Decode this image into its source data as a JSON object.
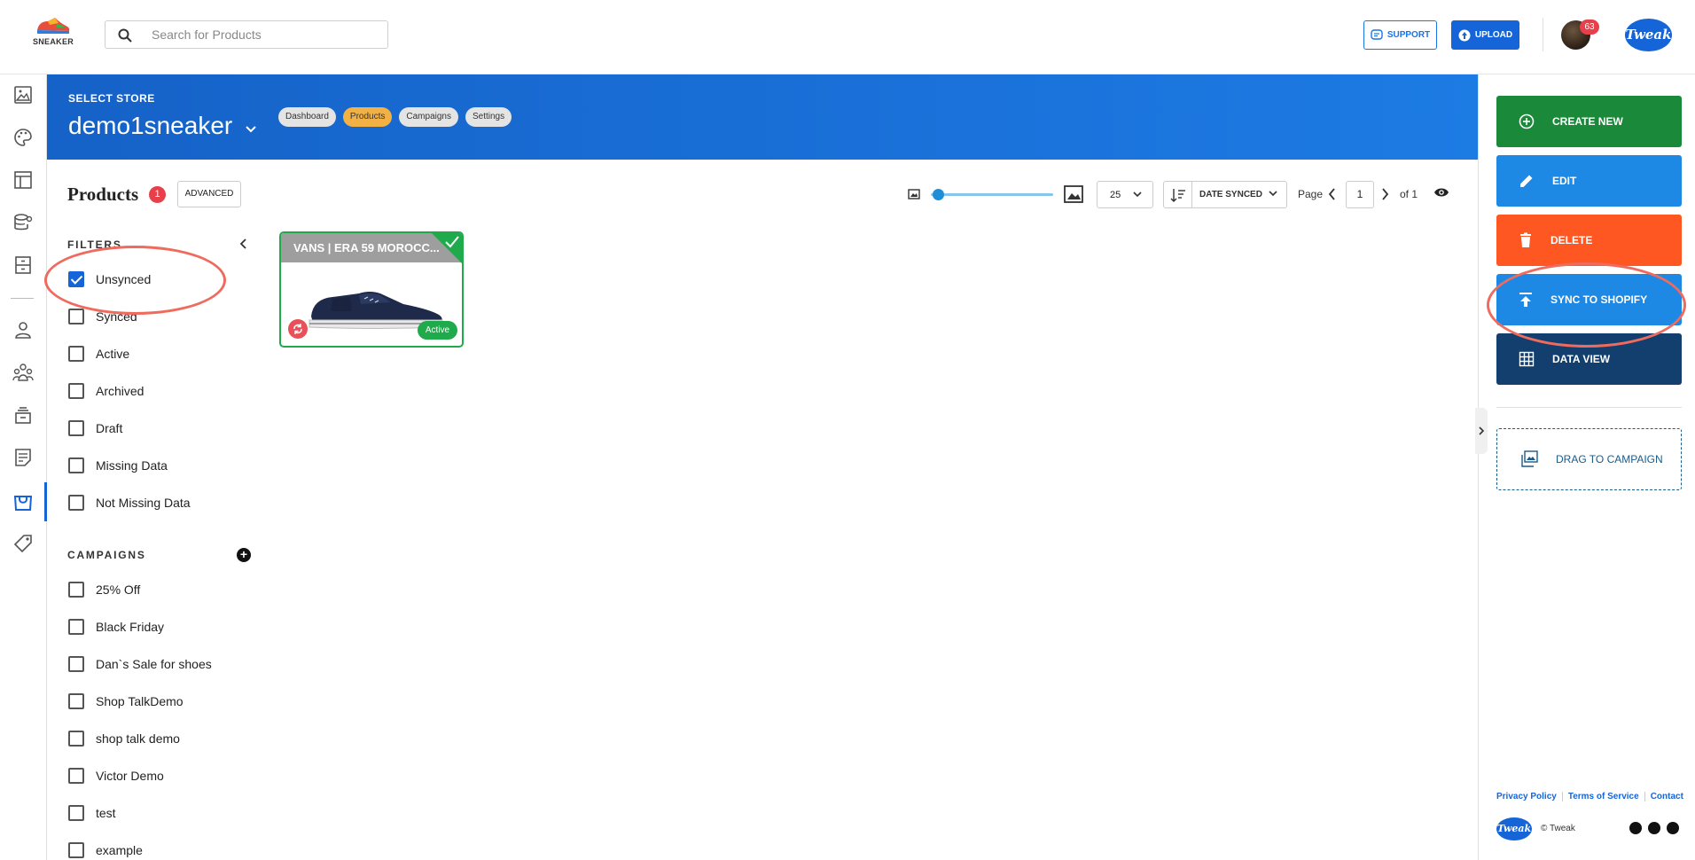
{
  "header": {
    "logo_text": "SNEAKER",
    "search_placeholder": "Search for Products",
    "support_label": "SUPPORT",
    "upload_label": "UPLOAD",
    "notification_count": "63",
    "brand_logo": "Tweak"
  },
  "banner": {
    "select_store_label": "SELECT STORE",
    "store_name": "demo1sneaker",
    "nav_pills": [
      "Dashboard",
      "Products",
      "Campaigns",
      "Settings"
    ],
    "active_pill": "Products"
  },
  "products": {
    "title": "Products",
    "count": "1",
    "advanced_label": "ADVANCED",
    "per_page": "25",
    "sort_label": "DATE SYNCED",
    "page_label": "Page",
    "page_current": "1",
    "page_of": "of 1",
    "image_size_slider": 0.05
  },
  "filters": {
    "heading": "FILTERS",
    "items": [
      {
        "label": "Unsynced",
        "checked": true
      },
      {
        "label": "Synced",
        "checked": false
      },
      {
        "label": "Active",
        "checked": false
      },
      {
        "label": "Archived",
        "checked": false
      },
      {
        "label": "Draft",
        "checked": false
      },
      {
        "label": "Missing Data",
        "checked": false
      },
      {
        "label": "Not Missing Data",
        "checked": false
      }
    ]
  },
  "campaigns": {
    "heading": "CAMPAIGNS",
    "items": [
      {
        "label": "25% Off",
        "checked": false
      },
      {
        "label": "Black Friday",
        "checked": false
      },
      {
        "label": "Dan`s Sale for shoes",
        "checked": false
      },
      {
        "label": "Shop TalkDemo",
        "checked": false
      },
      {
        "label": "shop talk demo",
        "checked": false
      },
      {
        "label": "Victor Demo",
        "checked": false
      },
      {
        "label": "test",
        "checked": false
      },
      {
        "label": "example",
        "checked": false
      }
    ]
  },
  "product_card": {
    "title": "VANS | ERA 59 MOROCC...",
    "status": "Active"
  },
  "actions": {
    "create_new": "CREATE NEW",
    "edit": "EDIT",
    "delete": "DELETE",
    "sync_to_shopify": "SYNC TO SHOPIFY",
    "data_view": "DATA VIEW",
    "drag_to_campaign": "DRAG TO CAMPAIGN"
  },
  "footer": {
    "links": [
      "Privacy Policy",
      "Terms of Service",
      "Contact"
    ],
    "logo": "Tweak",
    "copyright": "© Tweak"
  },
  "colors": {
    "banner_blue": "#1562c8",
    "create_green": "#1a8a3a",
    "edit_blue": "#1e88e5",
    "delete_orange": "#ff5722",
    "data_view_navy": "#123f6e",
    "active_pill": "#f2b145",
    "annotation_red": "#ee6b5e"
  },
  "nav_icons": [
    "image-icon",
    "palette-icon",
    "layout-icon",
    "database-settings-icon",
    "archive-icon",
    "person-icon",
    "group-icon",
    "stack-icon",
    "document-icon",
    "store-icon",
    "tag-icon"
  ]
}
